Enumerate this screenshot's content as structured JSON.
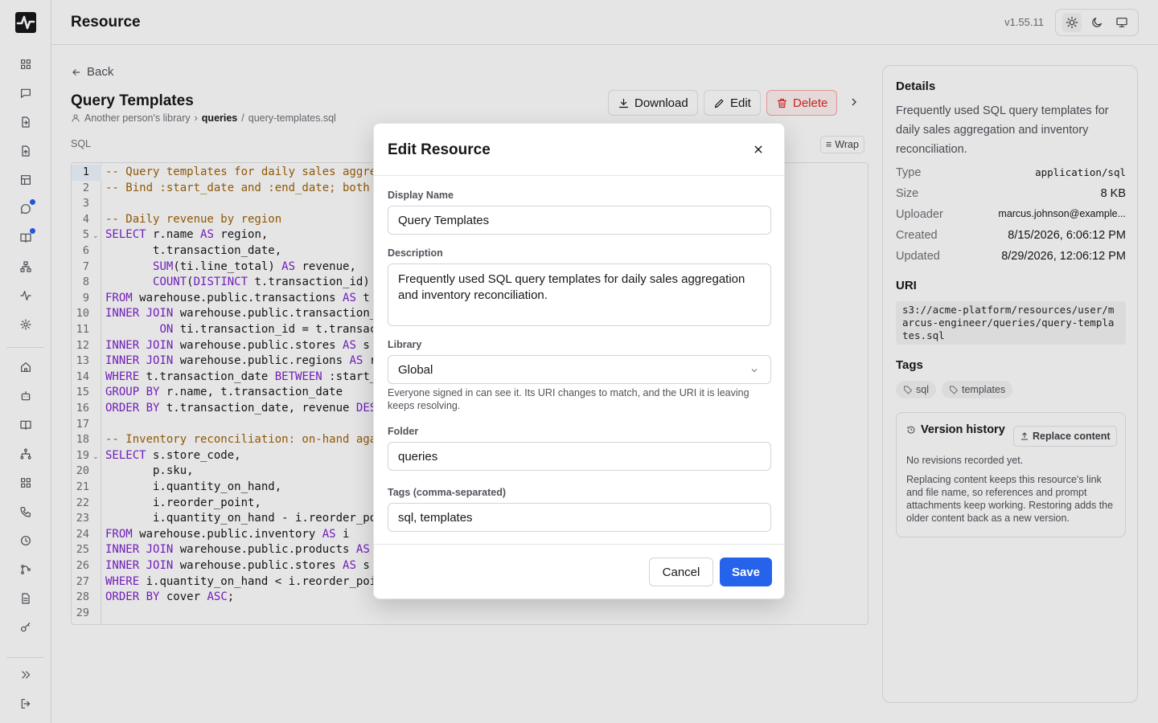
{
  "header": {
    "title": "Resource",
    "version": "v1.55.11"
  },
  "colors": {
    "accent": "#2563eb",
    "danger": "#dc2626",
    "comment": "#a16207",
    "keyword": "#7e22ce"
  },
  "sidebar": {
    "icons": [
      "grid-icon",
      "chat-icon",
      "file-import-icon",
      "file-upload-icon",
      "table-icon",
      "chat-notify-icon",
      "book-notify-icon",
      "network-icon",
      "activity-icon",
      "settings-icon",
      "home-icon",
      "robot-icon",
      "book-icon",
      "sitemap-icon",
      "apps-icon",
      "phone-icon",
      "clock-icon",
      "branch-icon",
      "document-icon",
      "key-icon"
    ],
    "bottom": [
      "expand-icon",
      "logout-icon"
    ]
  },
  "page": {
    "back": "Back",
    "title": "Query Templates",
    "breadcrumb": {
      "owner": "Another person's library",
      "folder": "queries",
      "sep": "/",
      "file": "query-templates.sql"
    },
    "actions": {
      "download": "Download",
      "edit": "Edit",
      "delete": "Delete"
    },
    "code_lang": "SQL",
    "wrap": "Wrap"
  },
  "code": {
    "lines": [
      "-- Query templates for daily sales aggre",
      "-- Bind :start_date and :end_date; both ",
      "",
      "-- Daily revenue by region",
      "SELECT r.name AS region,",
      "       t.transaction_date,",
      "       SUM(ti.line_total) AS revenue,",
      "       COUNT(DISTINCT t.transaction_id)",
      "FROM warehouse.public.transactions AS t",
      "INNER JOIN warehouse.public.transaction_",
      "        ON ti.transaction_id = t.transac",
      "INNER JOIN warehouse.public.stores AS s ",
      "INNER JOIN warehouse.public.regions AS r",
      "WHERE t.transaction_date BETWEEN :start_",
      "GROUP BY r.name, t.transaction_date",
      "ORDER BY t.transaction_date, revenue DES",
      "",
      "-- Inventory reconciliation: on-hand aga",
      "SELECT s.store_code,",
      "       p.sku,",
      "       i.quantity_on_hand,",
      "       i.reorder_point,",
      "       i.quantity_on_hand - i.reorder_po",
      "FROM warehouse.public.inventory AS i",
      "INNER JOIN warehouse.public.products AS ",
      "INNER JOIN warehouse.public.stores AS s ",
      "WHERE i.quantity_on_hand < i.reorder_poi",
      "ORDER BY cover ASC;",
      ""
    ]
  },
  "details": {
    "heading": "Details",
    "description": "Frequently used SQL query templates for daily sales aggregation and inventory reconciliation.",
    "rows": [
      {
        "key": "Type",
        "value": "application/sql"
      },
      {
        "key": "Size",
        "value": "8 KB"
      },
      {
        "key": "Uploader",
        "value": "marcus.johnson@example..."
      },
      {
        "key": "Created",
        "value": "8/15/2026, 6:06:12 PM"
      },
      {
        "key": "Updated",
        "value": "8/29/2026, 12:06:12 PM"
      }
    ],
    "uri_heading": "URI",
    "uri": "s3://acme-platform/resources/user/marcus-engineer/queries/query-templates.sql",
    "tags_heading": "Tags",
    "tags": [
      "sql",
      "templates"
    ],
    "version_history": {
      "title": "Version history",
      "replace": "Replace content",
      "empty": "No revisions recorded yet.",
      "note": "Replacing content keeps this resource's link and file name, so references and prompt attachments keep working. Restoring adds the older content back as a new version."
    }
  },
  "modal": {
    "title": "Edit Resource",
    "display_name_label": "Display Name",
    "display_name": "Query Templates",
    "description_label": "Description",
    "description": "Frequently used SQL query templates for daily sales aggregation and inventory reconciliation.",
    "library_label": "Library",
    "library": "Global",
    "library_help": "Everyone signed in can see it. Its URI changes to match, and the URI it is leaving keeps resolving.",
    "folder_label": "Folder",
    "folder": "queries",
    "tags_label": "Tags (comma-separated)",
    "tags": "sql, templates",
    "cancel": "Cancel",
    "save": "Save"
  }
}
